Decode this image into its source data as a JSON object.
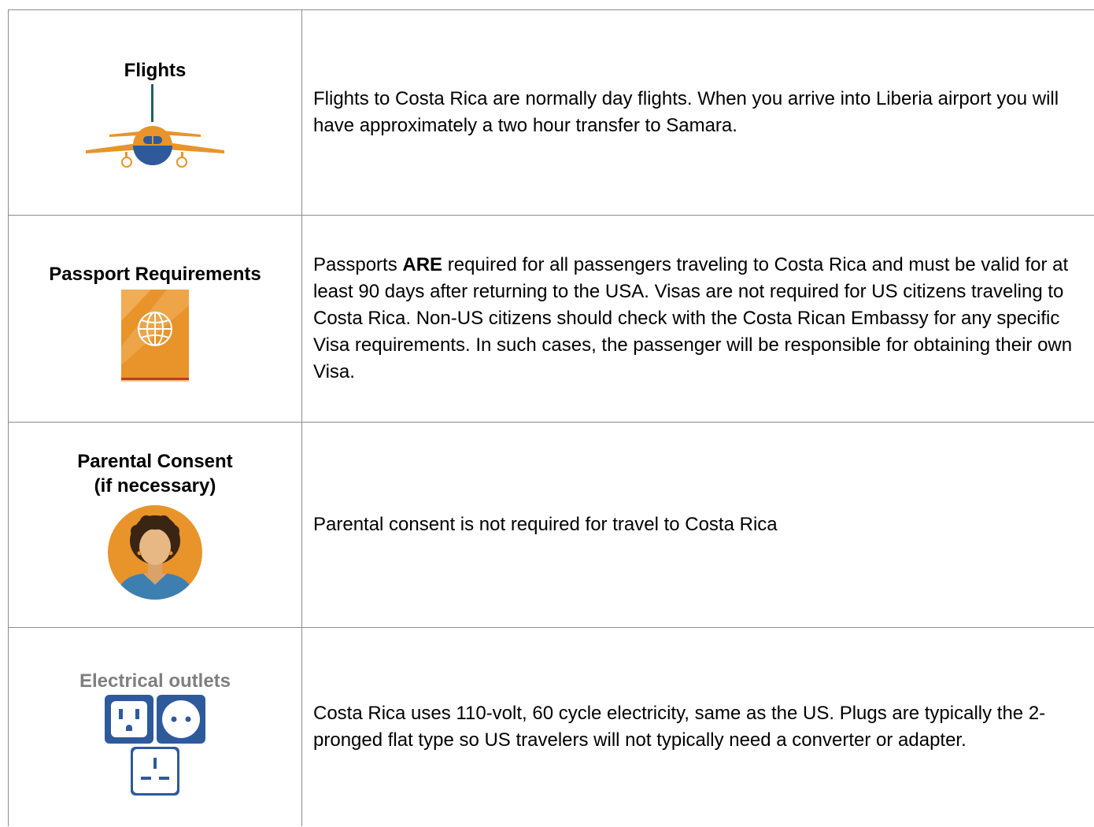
{
  "rows": [
    {
      "heading": "Flights",
      "icon": "airplane-icon",
      "text": "Flights to Costa Rica are normally day flights.  When you arrive into Liberia airport you will have approximately a two hour transfer to Samara."
    },
    {
      "heading": "Passport Requirements",
      "icon": "passport-icon",
      "text_before": "Passports ",
      "text_bold": "ARE",
      "text_after": " required for all passengers traveling to Costa Rica and must be valid for at least 90 days after returning to the USA.  Visas are not required for US citizens traveling to Costa Rica.  Non-US citizens should check with the Costa Rican Embassy for any specific Visa requirements.  In such cases, the passenger will be responsible for obtaining their own Visa."
    },
    {
      "heading_line1": "Parental Consent",
      "heading_line2": "(if necessary)",
      "icon": "parent-avatar-icon",
      "text": "Parental consent is not required for travel to Costa Rica"
    },
    {
      "heading": "Electrical outlets",
      "icon": "electrical-outlets-icon",
      "text": "Costa Rica uses 110-volt, 60 cycle electricity, same as the US. Plugs are typically the 2-pronged flat type so US travelers will not typically need a converter or adapter."
    }
  ],
  "colors": {
    "orange": "#e8942a",
    "navy": "#2e5a9c",
    "teal": "#1f5f6b",
    "border": "#8c8c8c",
    "heading_grey": "#7f7f7f"
  }
}
